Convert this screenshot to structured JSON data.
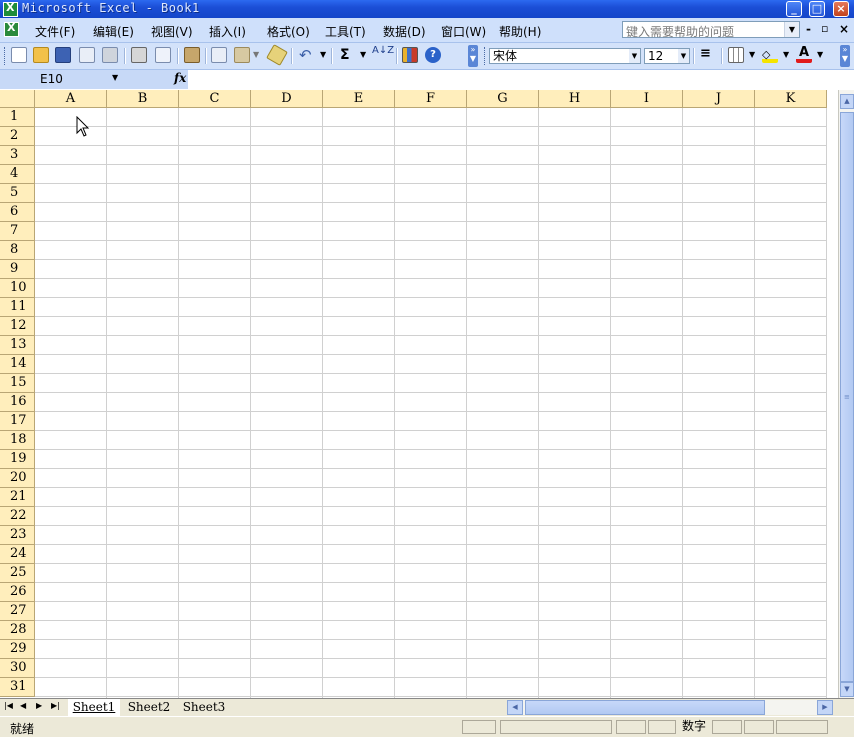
{
  "window": {
    "title": "Microsoft Excel - Book1"
  },
  "menu": [
    "文件(F)",
    "编辑(E)",
    "视图(V)",
    "插入(I)",
    "格式(O)",
    "工具(T)",
    "数据(D)",
    "窗口(W)",
    "帮助(H)"
  ],
  "help_box": {
    "placeholder": "键入需要帮助的问题"
  },
  "toolbar": {
    "font_name": "宋体",
    "font_size": "12",
    "sum_symbol": "Σ",
    "sort_label": "A↓Z"
  },
  "formula_bar": {
    "name_box": "E10",
    "fx": "fx",
    "content": ""
  },
  "columns": [
    "A",
    "B",
    "C",
    "D",
    "E",
    "F",
    "G",
    "H",
    "I",
    "J",
    "K"
  ],
  "rows": [
    "1",
    "2",
    "3",
    "4",
    "5",
    "6",
    "7",
    "8",
    "9",
    "10",
    "11",
    "12",
    "13",
    "14",
    "15",
    "16",
    "17",
    "18",
    "19",
    "20",
    "21",
    "22",
    "23",
    "24",
    "25",
    "26",
    "27",
    "28",
    "29",
    "30",
    "31"
  ],
  "sheets": [
    "Sheet1",
    "Sheet2",
    "Sheet3"
  ],
  "active_sheet": "Sheet1",
  "status": {
    "ready": "就绪",
    "num": "数字"
  },
  "colors": {
    "title_blue": "#1b4ed6",
    "header_bg": "#ffeebc",
    "toolbar_bg": "#d3e2fa"
  }
}
